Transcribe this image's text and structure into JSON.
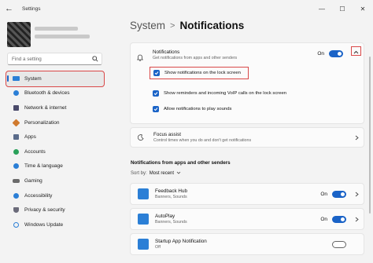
{
  "window": {
    "title": "Settings",
    "back_icon": "back-arrow-icon",
    "minimize_icon": "minimize-icon",
    "maximize_icon": "maximize-icon",
    "close_icon": "close-icon"
  },
  "search": {
    "placeholder": "Find a setting",
    "icon": "search-icon"
  },
  "sidebar": {
    "items": [
      {
        "label": "System",
        "icon": "system-icon",
        "color": "#2b7fd6",
        "active": true
      },
      {
        "label": "Bluetooth & devices",
        "icon": "bluetooth-icon",
        "color": "#2b7fd6"
      },
      {
        "label": "Network & internet",
        "icon": "network-icon",
        "color": "#4a4a6a"
      },
      {
        "label": "Personalization",
        "icon": "brush-icon",
        "color": "#d07a2e"
      },
      {
        "label": "Apps",
        "icon": "apps-icon",
        "color": "#5a6b8a"
      },
      {
        "label": "Accounts",
        "icon": "accounts-icon",
        "color": "#2aa15a"
      },
      {
        "label": "Time & language",
        "icon": "time-language-icon",
        "color": "#2b7fd6"
      },
      {
        "label": "Gaming",
        "icon": "gaming-icon",
        "color": "#6b6b6b"
      },
      {
        "label": "Accessibility",
        "icon": "accessibility-icon",
        "color": "#2b7fd6"
      },
      {
        "label": "Privacy & security",
        "icon": "shield-icon",
        "color": "#6b6b7a"
      },
      {
        "label": "Windows Update",
        "icon": "update-icon",
        "color": "#2b7fd6"
      }
    ]
  },
  "breadcrumb": {
    "parent": "System",
    "separator": ">",
    "current": "Notifications"
  },
  "notifications": {
    "title": "Notifications",
    "subtitle": "Get notifications from apps and other senders",
    "state": "On",
    "icon": "bell-icon",
    "options": [
      {
        "label": "Show notifications on the lock screen",
        "checked": true
      },
      {
        "label": "Show reminders and incoming VoIP calls on the lock screen",
        "checked": true
      },
      {
        "label": "Allow notifications to play sounds",
        "checked": true
      }
    ]
  },
  "focus_assist": {
    "title": "Focus assist",
    "subtitle": "Control times when you do and don't get notifications",
    "icon": "moon-icon"
  },
  "senders": {
    "title": "Notifications from apps and other senders",
    "sort_label": "Sort by:",
    "sort_value": "Most recent",
    "apps": [
      {
        "name": "Feedback Hub",
        "sub": "Banners, Sounds",
        "state": "On",
        "color": "#2b7fd6"
      },
      {
        "name": "AutoPlay",
        "sub": "Banners, Sounds",
        "state": "On",
        "color": "#2b7fd6"
      },
      {
        "name": "Startup App Notification",
        "sub": "Off",
        "state": "",
        "color": "#2b7fd6"
      }
    ]
  },
  "accent": "#1a63c7",
  "highlight": "#d94848"
}
